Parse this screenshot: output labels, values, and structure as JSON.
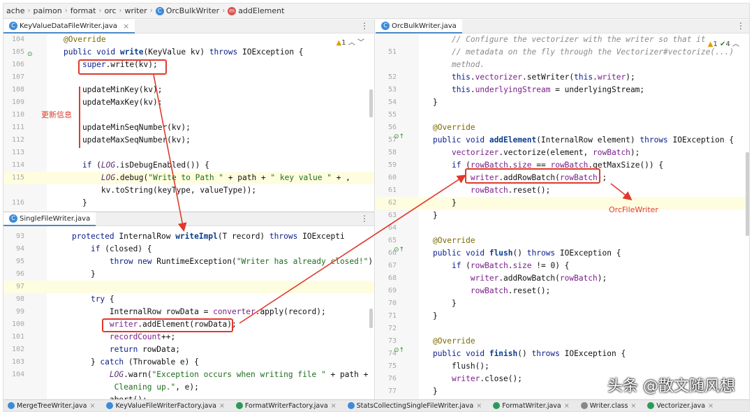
{
  "breadcrumb": [
    "ache",
    "paimon",
    "format",
    "orc",
    "writer",
    "OrcBulkWriter",
    "addElement"
  ],
  "tabs": {
    "top_left": "KeyValueDataFileWriter.java",
    "bottom_left": "SingleFileWriter.java",
    "right": "OrcBulkWriter.java"
  },
  "inspection": {
    "top_left": "1",
    "right_warn": "1",
    "right_ok": "4"
  },
  "annotations": {
    "update_info": "更新信息",
    "orc_file_writer": "OrcFileWriter"
  },
  "pane_top_left": [
    {
      "n": "104",
      "c": [
        [
          "an",
          "@Override"
        ]
      ]
    },
    {
      "n": "105",
      "c": [
        [
          "kw",
          "public void "
        ],
        [
          "fn",
          "write"
        ],
        [
          "",
          "(KeyValue kv) "
        ],
        [
          "kw",
          "throws"
        ],
        [
          "",
          " IOException {"
        ]
      ]
    },
    {
      "n": "106",
      "c": [
        [
          "",
          "    "
        ],
        [
          "kw",
          "super"
        ],
        [
          "",
          ".write(kv);"
        ]
      ]
    },
    {
      "n": "107",
      "c": []
    },
    {
      "n": "108",
      "c": [
        [
          "",
          "    updateMinKey(kv);"
        ]
      ]
    },
    {
      "n": "109",
      "c": [
        [
          "",
          "    updateMaxKey(kv);"
        ]
      ]
    },
    {
      "n": "110",
      "c": []
    },
    {
      "n": "111",
      "c": [
        [
          "",
          "    updateMinSeqNumber(kv);"
        ]
      ]
    },
    {
      "n": "112",
      "c": [
        [
          "",
          "    updateMaxSeqNumber(kv);"
        ]
      ]
    },
    {
      "n": "113",
      "c": []
    },
    {
      "n": "114",
      "c": [
        [
          "",
          "    "
        ],
        [
          "kw",
          "if"
        ],
        [
          "",
          " ("
        ],
        [
          "it",
          "LOG"
        ],
        [
          "",
          ".isDebugEnabled()) {"
        ]
      ]
    },
    {
      "n": "115",
      "c": [
        [
          "",
          "        "
        ],
        [
          "it",
          "LOG"
        ],
        [
          "",
          ".debug("
        ],
        [
          "st",
          "\"Write to Path \""
        ],
        [
          "",
          " + path + "
        ],
        [
          "st",
          "\" key value \""
        ],
        [
          "",
          " + ,"
        ]
      ]
    },
    {
      "n": "",
      "c": [
        [
          "",
          "        kv.toString(keyType, valueType));"
        ]
      ]
    },
    {
      "n": "116",
      "c": [
        [
          "",
          "    }"
        ]
      ]
    }
  ],
  "pane_bottom_left": [
    {
      "n": "93",
      "c": [
        [
          "kw",
          "protected "
        ],
        [
          "",
          "InternalRow "
        ],
        [
          "fn",
          "writeImpl"
        ],
        [
          "",
          "(T record) "
        ],
        [
          "kw",
          "throws"
        ],
        [
          "",
          " IOExcepti"
        ]
      ]
    },
    {
      "n": "94",
      "c": [
        [
          "",
          "    "
        ],
        [
          "kw",
          "if"
        ],
        [
          "",
          " (closed) {"
        ]
      ]
    },
    {
      "n": "95",
      "c": [
        [
          "",
          "        "
        ],
        [
          "kw",
          "throw new "
        ],
        [
          "",
          "RuntimeException("
        ],
        [
          "st",
          "\"Writer has already closed!\""
        ],
        [
          "",
          ");"
        ]
      ]
    },
    {
      "n": "96",
      "c": [
        [
          "",
          "    }"
        ]
      ]
    },
    {
      "n": "97",
      "c": []
    },
    {
      "n": "98",
      "c": [
        [
          "",
          "    "
        ],
        [
          "kw",
          "try"
        ],
        [
          "",
          " {"
        ]
      ]
    },
    {
      "n": "99",
      "c": [
        [
          "",
          "        InternalRow rowData = "
        ],
        [
          "fld",
          "converter"
        ],
        [
          "",
          ".apply(record);"
        ]
      ]
    },
    {
      "n": "100",
      "c": [
        [
          "",
          "        "
        ],
        [
          "fld",
          "writer"
        ],
        [
          "",
          ".addElement(rowData);"
        ]
      ]
    },
    {
      "n": "101",
      "c": [
        [
          "",
          "        "
        ],
        [
          "fld",
          "recordCount"
        ],
        [
          "",
          "++;"
        ]
      ]
    },
    {
      "n": "102",
      "c": [
        [
          "",
          "        "
        ],
        [
          "kw",
          "return"
        ],
        [
          "",
          " rowData;"
        ]
      ]
    },
    {
      "n": "103",
      "c": [
        [
          "",
          "    } "
        ],
        [
          "kw",
          "catch"
        ],
        [
          "",
          " (Throwable e) {"
        ]
      ]
    },
    {
      "n": "104",
      "c": [
        [
          "",
          "        "
        ],
        [
          "it",
          "LOG"
        ],
        [
          "",
          ".warn("
        ],
        [
          "st",
          "\"Exception occurs when writing file \""
        ],
        [
          "",
          " + path + \"."
        ]
      ]
    },
    {
      "n": "",
      "c": [
        [
          "",
          "         "
        ],
        [
          "st",
          "Cleaning up.\""
        ],
        [
          "",
          ", e);"
        ]
      ]
    },
    {
      "n": "",
      "c": [
        [
          "",
          "        abort();"
        ]
      ]
    }
  ],
  "pane_right": [
    {
      "n": "",
      "c": [
        [
          "cm",
          "    // Configure the vectorizer with the writer so that it"
        ]
      ]
    },
    {
      "n": "51",
      "c": [
        [
          "cm",
          "    // metadata on the fly through the Vectorizer#vectorize(...)"
        ]
      ]
    },
    {
      "n": "",
      "c": [
        [
          "cm",
          "    method."
        ]
      ]
    },
    {
      "n": "52",
      "c": [
        [
          "",
          "    "
        ],
        [
          "kw",
          "this"
        ],
        [
          "",
          "."
        ],
        [
          "fld",
          "vectorizer"
        ],
        [
          "",
          ".setWriter("
        ],
        [
          "kw",
          "this"
        ],
        [
          "",
          "."
        ],
        [
          "fld",
          "writer"
        ],
        [
          "",
          ");"
        ]
      ]
    },
    {
      "n": "53",
      "c": [
        [
          "",
          "    "
        ],
        [
          "kw",
          "this"
        ],
        [
          "",
          "."
        ],
        [
          "fld",
          "underlyingStream"
        ],
        [
          "",
          " = underlyingStream;"
        ]
      ]
    },
    {
      "n": "54",
      "c": [
        [
          "",
          "}"
        ]
      ]
    },
    {
      "n": "55",
      "c": []
    },
    {
      "n": "56",
      "c": [
        [
          "an",
          "@Override"
        ]
      ]
    },
    {
      "n": "57",
      "c": [
        [
          "kw",
          "public void "
        ],
        [
          "fn",
          "addElement"
        ],
        [
          "",
          "(InternalRow element) "
        ],
        [
          "kw",
          "throws"
        ],
        [
          "",
          " IOException {"
        ]
      ]
    },
    {
      "n": "58",
      "c": [
        [
          "",
          "    "
        ],
        [
          "fld",
          "vectorizer"
        ],
        [
          "",
          ".vectorize(element, "
        ],
        [
          "fld",
          "rowBatch"
        ],
        [
          "",
          ");"
        ]
      ]
    },
    {
      "n": "59",
      "c": [
        [
          "",
          "    "
        ],
        [
          "kw",
          "if"
        ],
        [
          "",
          " ("
        ],
        [
          "fld",
          "rowBatch"
        ],
        [
          "",
          "."
        ],
        [
          "fld",
          "size"
        ],
        [
          "",
          " == "
        ],
        [
          "fld",
          "rowBatch"
        ],
        [
          "",
          ".getMaxSize()) {"
        ]
      ]
    },
    {
      "n": "60",
      "c": [
        [
          "",
          "        "
        ],
        [
          "fld",
          "writer"
        ],
        [
          "",
          ".addRowBatch("
        ],
        [
          "fld",
          "rowBatch"
        ],
        [
          "",
          ");"
        ]
      ]
    },
    {
      "n": "61",
      "c": [
        [
          "",
          "        "
        ],
        [
          "fld",
          "rowBatch"
        ],
        [
          "",
          ".reset();"
        ]
      ]
    },
    {
      "n": "62",
      "c": [
        [
          "",
          "    }"
        ]
      ]
    },
    {
      "n": "63",
      "c": [
        [
          "",
          "}"
        ]
      ]
    },
    {
      "n": "64",
      "c": []
    },
    {
      "n": "65",
      "c": [
        [
          "an",
          "@Override"
        ]
      ]
    },
    {
      "n": "66",
      "c": [
        [
          "kw",
          "public void "
        ],
        [
          "fn",
          "flush"
        ],
        [
          "",
          "() "
        ],
        [
          "kw",
          "throws"
        ],
        [
          "",
          " IOException {"
        ]
      ]
    },
    {
      "n": "67",
      "c": [
        [
          "",
          "    "
        ],
        [
          "kw",
          "if"
        ],
        [
          "",
          " ("
        ],
        [
          "fld",
          "rowBatch"
        ],
        [
          "",
          "."
        ],
        [
          "fld",
          "size"
        ],
        [
          "",
          " != 0) {"
        ]
      ]
    },
    {
      "n": "68",
      "c": [
        [
          "",
          "        "
        ],
        [
          "fld",
          "writer"
        ],
        [
          "",
          ".addRowBatch("
        ],
        [
          "fld",
          "rowBatch"
        ],
        [
          "",
          ");"
        ]
      ]
    },
    {
      "n": "69",
      "c": [
        [
          "",
          "        "
        ],
        [
          "fld",
          "rowBatch"
        ],
        [
          "",
          ".reset();"
        ]
      ]
    },
    {
      "n": "70",
      "c": [
        [
          "",
          "    }"
        ]
      ]
    },
    {
      "n": "71",
      "c": [
        [
          "",
          "}"
        ]
      ]
    },
    {
      "n": "72",
      "c": []
    },
    {
      "n": "73",
      "c": [
        [
          "an",
          "@Override"
        ]
      ]
    },
    {
      "n": "74",
      "c": [
        [
          "kw",
          "public void "
        ],
        [
          "fn",
          "finish"
        ],
        [
          "",
          "() "
        ],
        [
          "kw",
          "throws"
        ],
        [
          "",
          " IOException {"
        ]
      ]
    },
    {
      "n": "75",
      "c": [
        [
          "",
          "    flush();"
        ]
      ]
    },
    {
      "n": "76",
      "c": [
        [
          "",
          "    "
        ],
        [
          "fld",
          "writer"
        ],
        [
          "",
          ".close();"
        ]
      ]
    },
    {
      "n": "77",
      "c": [
        [
          "",
          "}"
        ]
      ]
    }
  ],
  "bottom_tabs": [
    "MergeTreeWriter.java",
    "KeyValueFileWriterFactory.java",
    "FormatWriterFactory.java",
    "StatsCollectingSingleFileWriter.java",
    "FormatWriter.java",
    "Writer.class",
    "Vectorizer.java"
  ],
  "watermark": "头条 @散文随风想"
}
